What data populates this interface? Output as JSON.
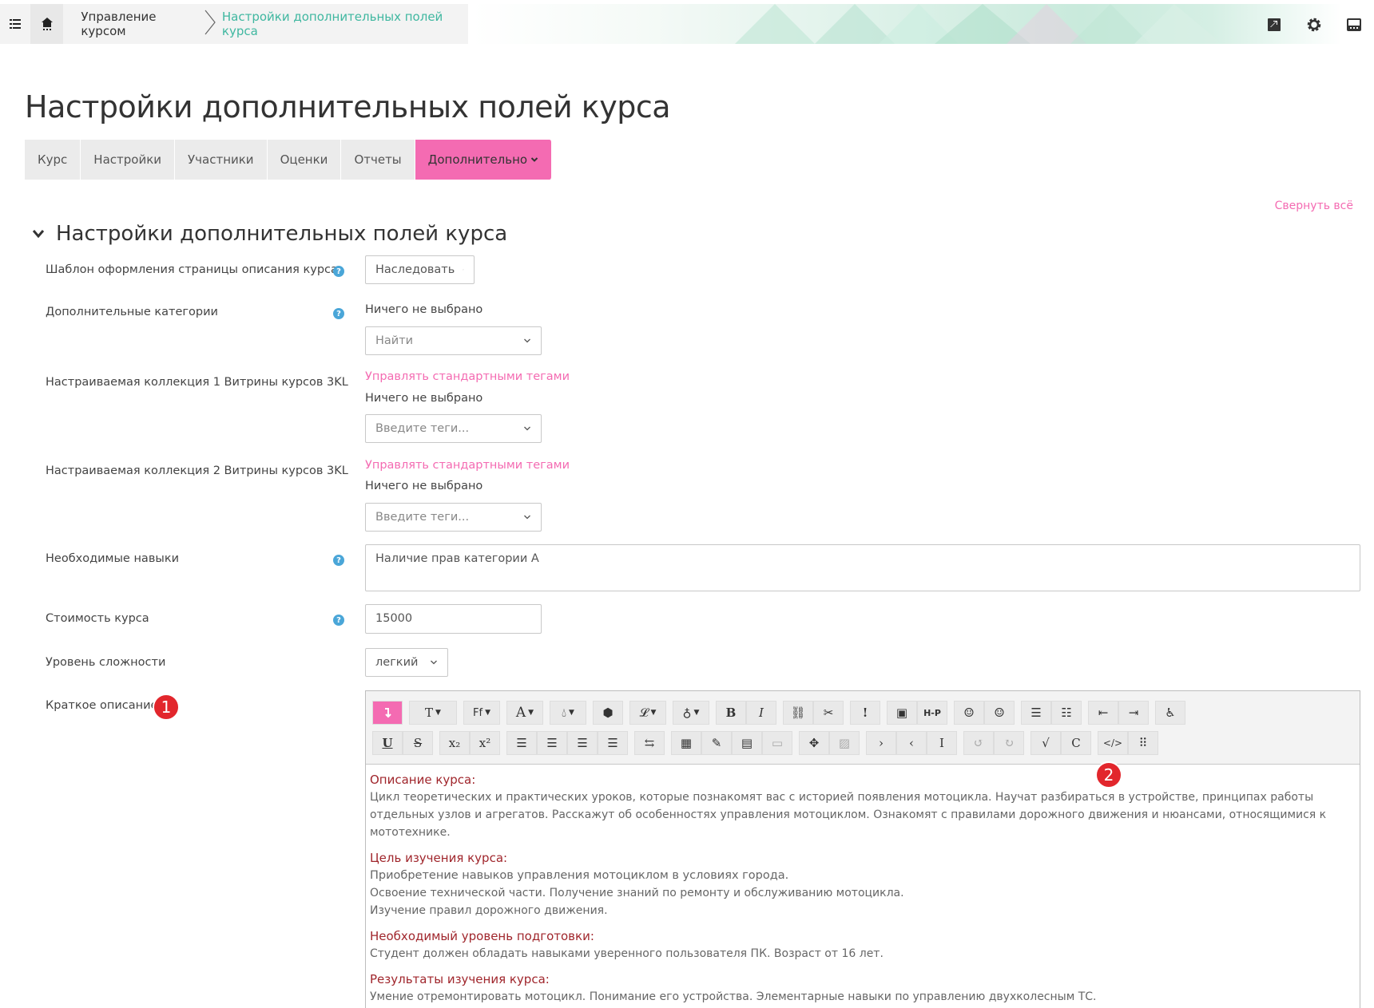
{
  "breadcrumb": {
    "course_mgmt": "Управление курсом",
    "current": "Настройки дополнительных полей курса"
  },
  "page": {
    "title": "Настройки дополнительных полей курса",
    "collapse_all": "Свернуть всё"
  },
  "tabs": [
    {
      "label": "Курс"
    },
    {
      "label": "Настройки"
    },
    {
      "label": "Участники"
    },
    {
      "label": "Оценки"
    },
    {
      "label": "Отчеты"
    },
    {
      "label": "Дополнительно"
    }
  ],
  "section": {
    "title": "Настройки дополнительных полей курса"
  },
  "fields": {
    "template": {
      "label": "Шаблон оформления страницы описания курса",
      "value": "Наследовать"
    },
    "extra_categories": {
      "label": "Дополнительные категории",
      "none": "Ничего не выбрано",
      "placeholder": "Найти"
    },
    "collection1": {
      "label": "Настраиваемая коллекция 1 Витрины курсов 3KL",
      "manage": "Управлять стандартными тегами",
      "none": "Ничего не выбрано",
      "placeholder": "Введите теги..."
    },
    "collection2": {
      "label": "Настраиваемая коллекция 2 Витрины курсов 3KL",
      "manage": "Управлять стандартными тегами",
      "none": "Ничего не выбрано",
      "placeholder": "Введите теги..."
    },
    "skills": {
      "label": "Необходимые навыки",
      "value": "Наличие прав категории А"
    },
    "cost": {
      "label": "Стоимость курса",
      "value": "15000"
    },
    "difficulty": {
      "label": "Уровень сложности",
      "value": "легкий"
    },
    "short_desc": {
      "label": "Краткое описание"
    }
  },
  "badges": {
    "one": "1",
    "two": "2"
  },
  "editor": {
    "toolbar_labels": {
      "bold": "B",
      "italic": "I",
      "underline": "U",
      "strike": "S",
      "sub": "x₂",
      "sup": "x²",
      "hp": "H-P",
      "font": "Ff",
      "fontsize": "A",
      "textstyle": "T"
    },
    "content": [
      {
        "heading": "Описание курса:",
        "lines": [
          "Цикл теоретических и практических уроков, которые познакомят вас с историей появления мотоцикла. Научат разбираться в устройстве, принципах работы отдельных узлов и агрегатов. Расскажут об особенностях управления мотоциклом.  Ознакомят с правилами дорожного движения и нюансами, относящимися к мототехнике."
        ]
      },
      {
        "heading": "Цель изучения курса:",
        "lines": [
          "Приобретение навыков управления мотоциклом в условиях города.",
          "Освоение технической части. Получение знаний по ремонту и обслуживанию мотоцикла.",
          "Изучение правил дорожного движения."
        ]
      },
      {
        "heading": "Необходимый уровень подготовки:",
        "lines": [
          "Студент должен обладать навыками уверенного пользователя ПК. Возраст от 16 лет."
        ]
      },
      {
        "heading": "Результаты изучения курса:",
        "lines": [
          "Умение отремонтировать мотоцикл. Понимание его устройства. Элементарные навыки по управлению двухколесным ТС."
        ]
      }
    ]
  },
  "colors": {
    "accent": "#f46bb2",
    "teal": "#3fb7a0",
    "heading_red": "#a0262c",
    "badge_red": "#e2262c",
    "help_blue": "#4aa6d8"
  }
}
